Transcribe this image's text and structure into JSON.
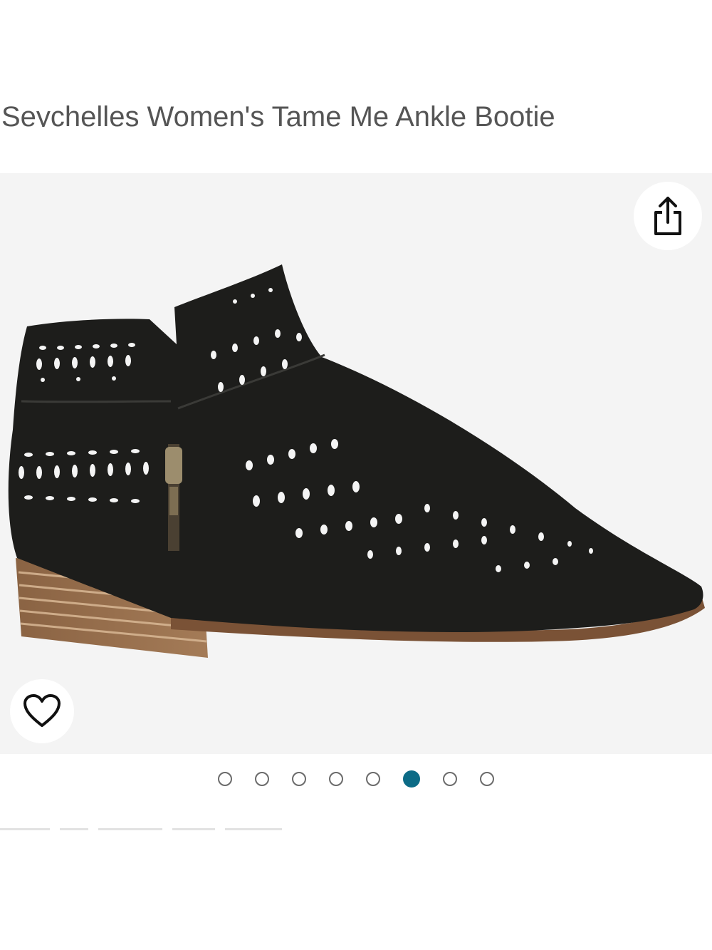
{
  "product": {
    "title": "Seychelles Women's Tame Me Ankle Bootie"
  },
  "gallery": {
    "image_alt": "black perforated leather ankle bootie with side zipper and stacked wooden heel",
    "image_count": 8,
    "active_index": 5,
    "share_icon": "share-icon",
    "favorite_icon": "heart-icon"
  },
  "colors": {
    "accent": "#0c6b86",
    "background": "#f4f4f4"
  }
}
